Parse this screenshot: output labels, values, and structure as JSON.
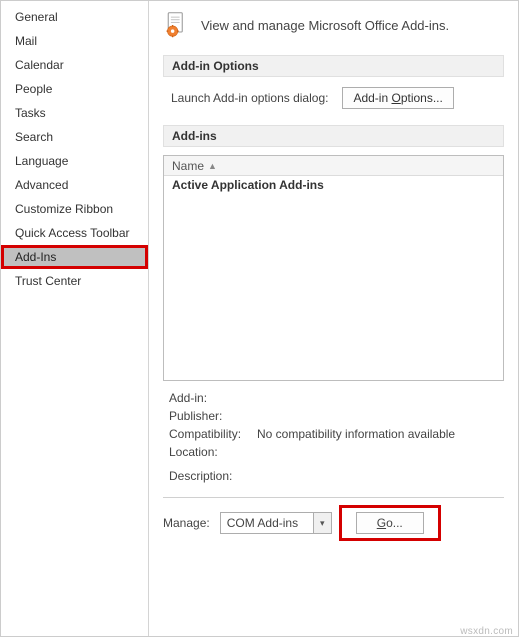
{
  "sidebar": {
    "items": [
      {
        "label": "General"
      },
      {
        "label": "Mail"
      },
      {
        "label": "Calendar"
      },
      {
        "label": "People"
      },
      {
        "label": "Tasks"
      },
      {
        "label": "Search"
      },
      {
        "label": "Language"
      },
      {
        "label": "Advanced"
      },
      {
        "label": "Customize Ribbon"
      },
      {
        "label": "Quick Access Toolbar"
      },
      {
        "label": "Add-Ins"
      },
      {
        "label": "Trust Center"
      }
    ],
    "selected_index": 10
  },
  "header": {
    "title": "View and manage Microsoft Office Add-ins."
  },
  "sections": {
    "options_title": "Add-in Options",
    "addins_title": "Add-ins"
  },
  "launch": {
    "label": "Launch Add-in options dialog:",
    "button": "Add-in Options..."
  },
  "addins_list": {
    "column_header": "Name",
    "group_header": "Active Application Add-ins"
  },
  "details": {
    "addin_label": "Add-in:",
    "publisher_label": "Publisher:",
    "compat_label": "Compatibility:",
    "compat_value": "No compatibility information available",
    "location_label": "Location:",
    "description_label": "Description:"
  },
  "manage": {
    "label": "Manage:",
    "selected": "COM Add-ins",
    "go_label": "Go..."
  },
  "watermark": "wsxdn.com"
}
